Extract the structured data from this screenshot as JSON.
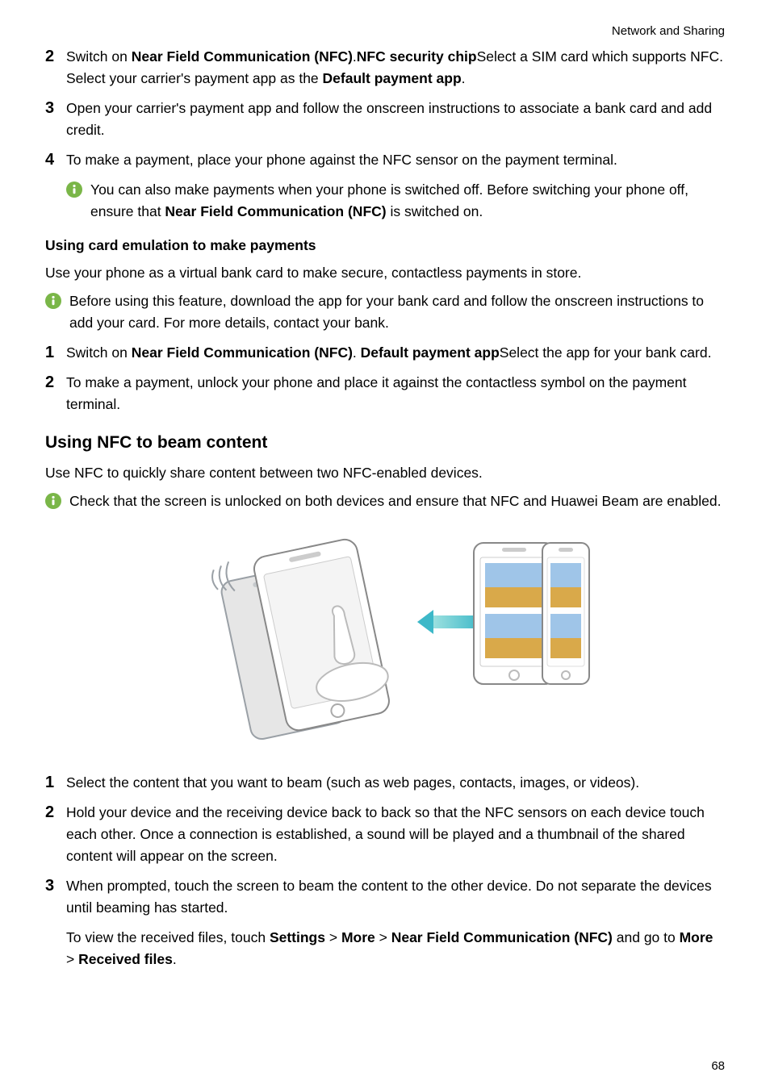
{
  "header": "Network and Sharing",
  "section1": {
    "items": [
      {
        "num": "2",
        "parts": [
          {
            "t": "Switch on "
          },
          {
            "t": "Near Field Communication (NFC)",
            "b": true
          },
          {
            "t": "."
          },
          {
            "t": "NFC security chip",
            "b": true
          },
          {
            "t": "Select a SIM card which supports NFC. Select your carrier's payment app as the "
          },
          {
            "t": "Default payment app",
            "b": true
          },
          {
            "t": "."
          }
        ]
      },
      {
        "num": "3",
        "parts": [
          {
            "t": "Open your carrier's payment app and follow the onscreen instructions to associate a bank card and add credit."
          }
        ]
      },
      {
        "num": "4",
        "parts": [
          {
            "t": "To make a payment, place your phone against the NFC sensor on the payment terminal."
          }
        ]
      }
    ],
    "note_parts": [
      {
        "t": "You can also make payments when your phone is switched off. Before switching your phone off, ensure that "
      },
      {
        "t": "Near Field Communication (NFC)",
        "b": true
      },
      {
        "t": " is switched on."
      }
    ]
  },
  "section2": {
    "heading": "Using card emulation to make payments",
    "intro": "Use your phone as a virtual bank card to make secure, contactless payments in store.",
    "note_parts": [
      {
        "t": "Before using this feature, download the app for your bank card and follow the onscreen instructions to add your card. For more details, contact your bank."
      }
    ],
    "items": [
      {
        "num": "1",
        "parts": [
          {
            "t": "Switch on "
          },
          {
            "t": "Near Field Communication (NFC)",
            "b": true
          },
          {
            "t": ". "
          },
          {
            "t": "Default payment app",
            "b": true
          },
          {
            "t": "Select the app for your bank card."
          }
        ]
      },
      {
        "num": "2",
        "parts": [
          {
            "t": "To make a payment, unlock your phone and place it against the contactless symbol on the payment terminal."
          }
        ]
      }
    ]
  },
  "section3": {
    "heading": "Using NFC to beam content",
    "intro": "Use NFC to quickly share content between two NFC-enabled devices.",
    "note_parts": [
      {
        "t": "Check that the screen is unlocked on both devices and ensure that NFC and Huawei Beam are enabled."
      }
    ],
    "items": [
      {
        "num": "1",
        "parts": [
          {
            "t": "Select the content that you want to beam (such as web pages, contacts, images, or videos)."
          }
        ]
      },
      {
        "num": "2",
        "parts": [
          {
            "t": "Hold your device and the receiving device back to back so that the NFC sensors on each device touch each other. Once a connection is established, a sound will be played and a thumbnail of the shared content will appear on the screen."
          }
        ]
      },
      {
        "num": "3",
        "parts": [
          {
            "t": "When prompted, touch the screen to beam the content to the other device. Do not separate the devices until beaming has started."
          }
        ]
      }
    ],
    "tail_parts": [
      {
        "t": "To view the received files, touch "
      },
      {
        "t": "Settings",
        "b": true
      },
      {
        "t": " > "
      },
      {
        "t": "More",
        "b": true
      },
      {
        "t": " > "
      },
      {
        "t": "Near Field Communication (NFC)",
        "b": true
      },
      {
        "t": " and go to "
      },
      {
        "t": "More",
        "b": true
      },
      {
        "t": " > "
      },
      {
        "t": "Received files",
        "b": true
      },
      {
        "t": "."
      }
    ]
  },
  "pageNumber": "68"
}
